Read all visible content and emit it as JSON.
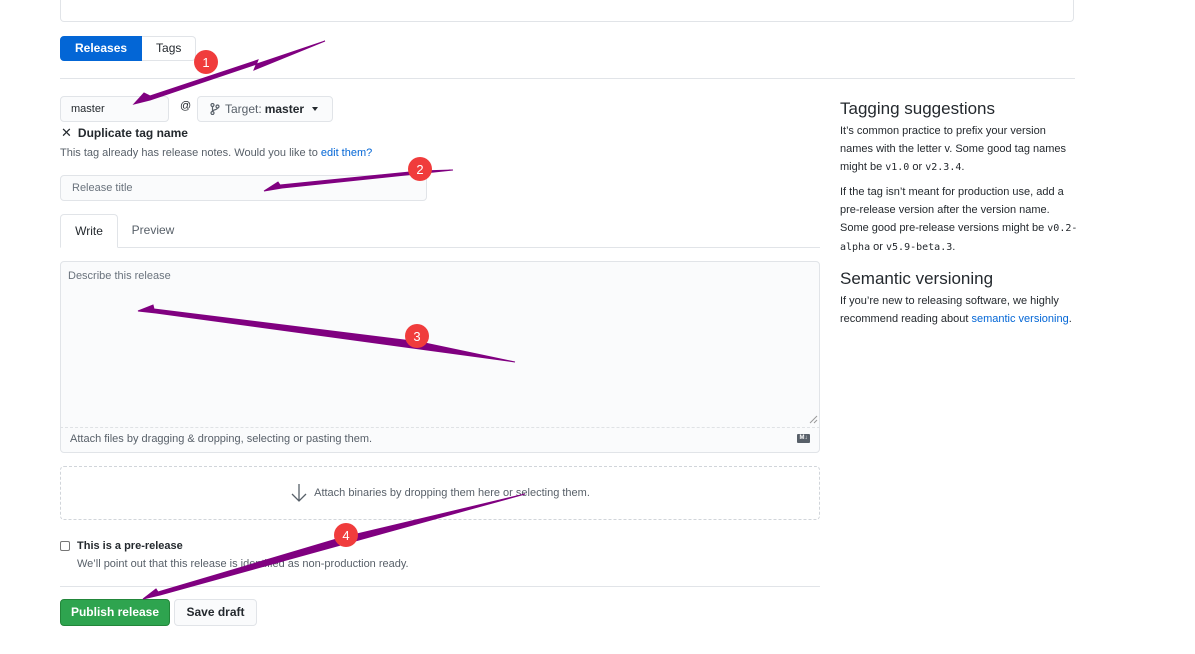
{
  "tabs": {
    "releases": "Releases",
    "tags": "Tags"
  },
  "tag": {
    "value": "master",
    "at": "@",
    "target_label": "Target:",
    "target_value": "master"
  },
  "duplicate": {
    "title": "Duplicate tag name",
    "note": "This tag already has release notes. Would you like to ",
    "link": "edit them?"
  },
  "release_title": {
    "placeholder": "Release title"
  },
  "editor": {
    "write_tab": "Write",
    "preview_tab": "Preview",
    "placeholder": "Describe this release",
    "attach_text": "Attach files by dragging & dropping, selecting or pasting them.",
    "md_badge": "M↓"
  },
  "binaries": {
    "text": "Attach binaries by dropping them here or selecting them."
  },
  "prerelease": {
    "label": "This is a pre-release",
    "note": "We’ll point out that this release is identified as non-production ready."
  },
  "actions": {
    "publish": "Publish release",
    "save_draft": "Save draft"
  },
  "sidebar": {
    "tagging_title": "Tagging suggestions",
    "tagging_p1_a": "It’s common practice to prefix your version names with the letter v. Some good tag names might be ",
    "tagging_p1_code1": "v1.0",
    "tagging_p1_b": " or ",
    "tagging_p1_code2": "v2.3.4",
    "tagging_p1_c": ".",
    "tagging_p2_a": "If the tag isn’t meant for production use, add a pre-release version after the version name. Some good pre-release versions might be ",
    "tagging_p2_code1": "v0.2-alpha",
    "tagging_p2_b": " or ",
    "tagging_p2_code2": "v5.9-beta.3",
    "tagging_p2_c": ".",
    "semver_title": "Semantic versioning",
    "semver_text": "If you’re new to releasing software, we highly recommend reading about ",
    "semver_link": "semantic versioning",
    "semver_end": "."
  },
  "annotations": {
    "marker1": "1",
    "marker2": "2",
    "marker3": "3",
    "marker4": "4",
    "arrow_color": "#800080",
    "marker_color": "#f03c3c"
  },
  "colors": {
    "primary_blue": "#0366d6",
    "publish_green": "#2ea44f"
  }
}
